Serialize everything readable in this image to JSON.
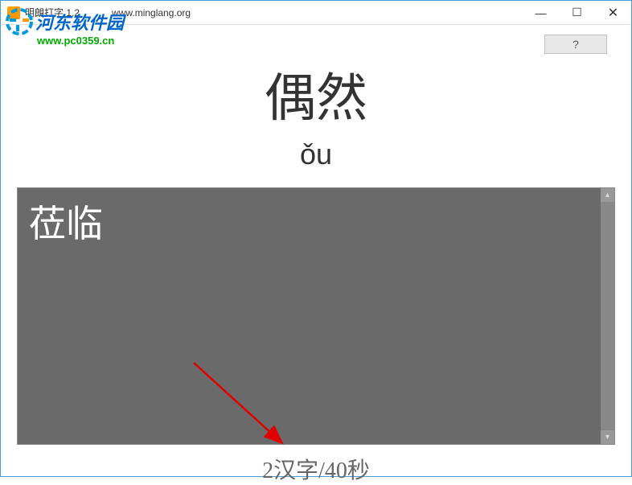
{
  "titlebar": {
    "title": "明朗打字 1.2",
    "url": "www.minglang.org"
  },
  "window_controls": {
    "minimize": "—",
    "maximize": "☐",
    "close": "✕"
  },
  "watermark": {
    "text": "河东软件园",
    "url": "www.pc0359.cn"
  },
  "help_button": {
    "label": "?"
  },
  "practice": {
    "target_word": "偶然",
    "pinyin": "ǒu",
    "typed_text": "莅临"
  },
  "status": {
    "text": "2汉字/40秒"
  }
}
